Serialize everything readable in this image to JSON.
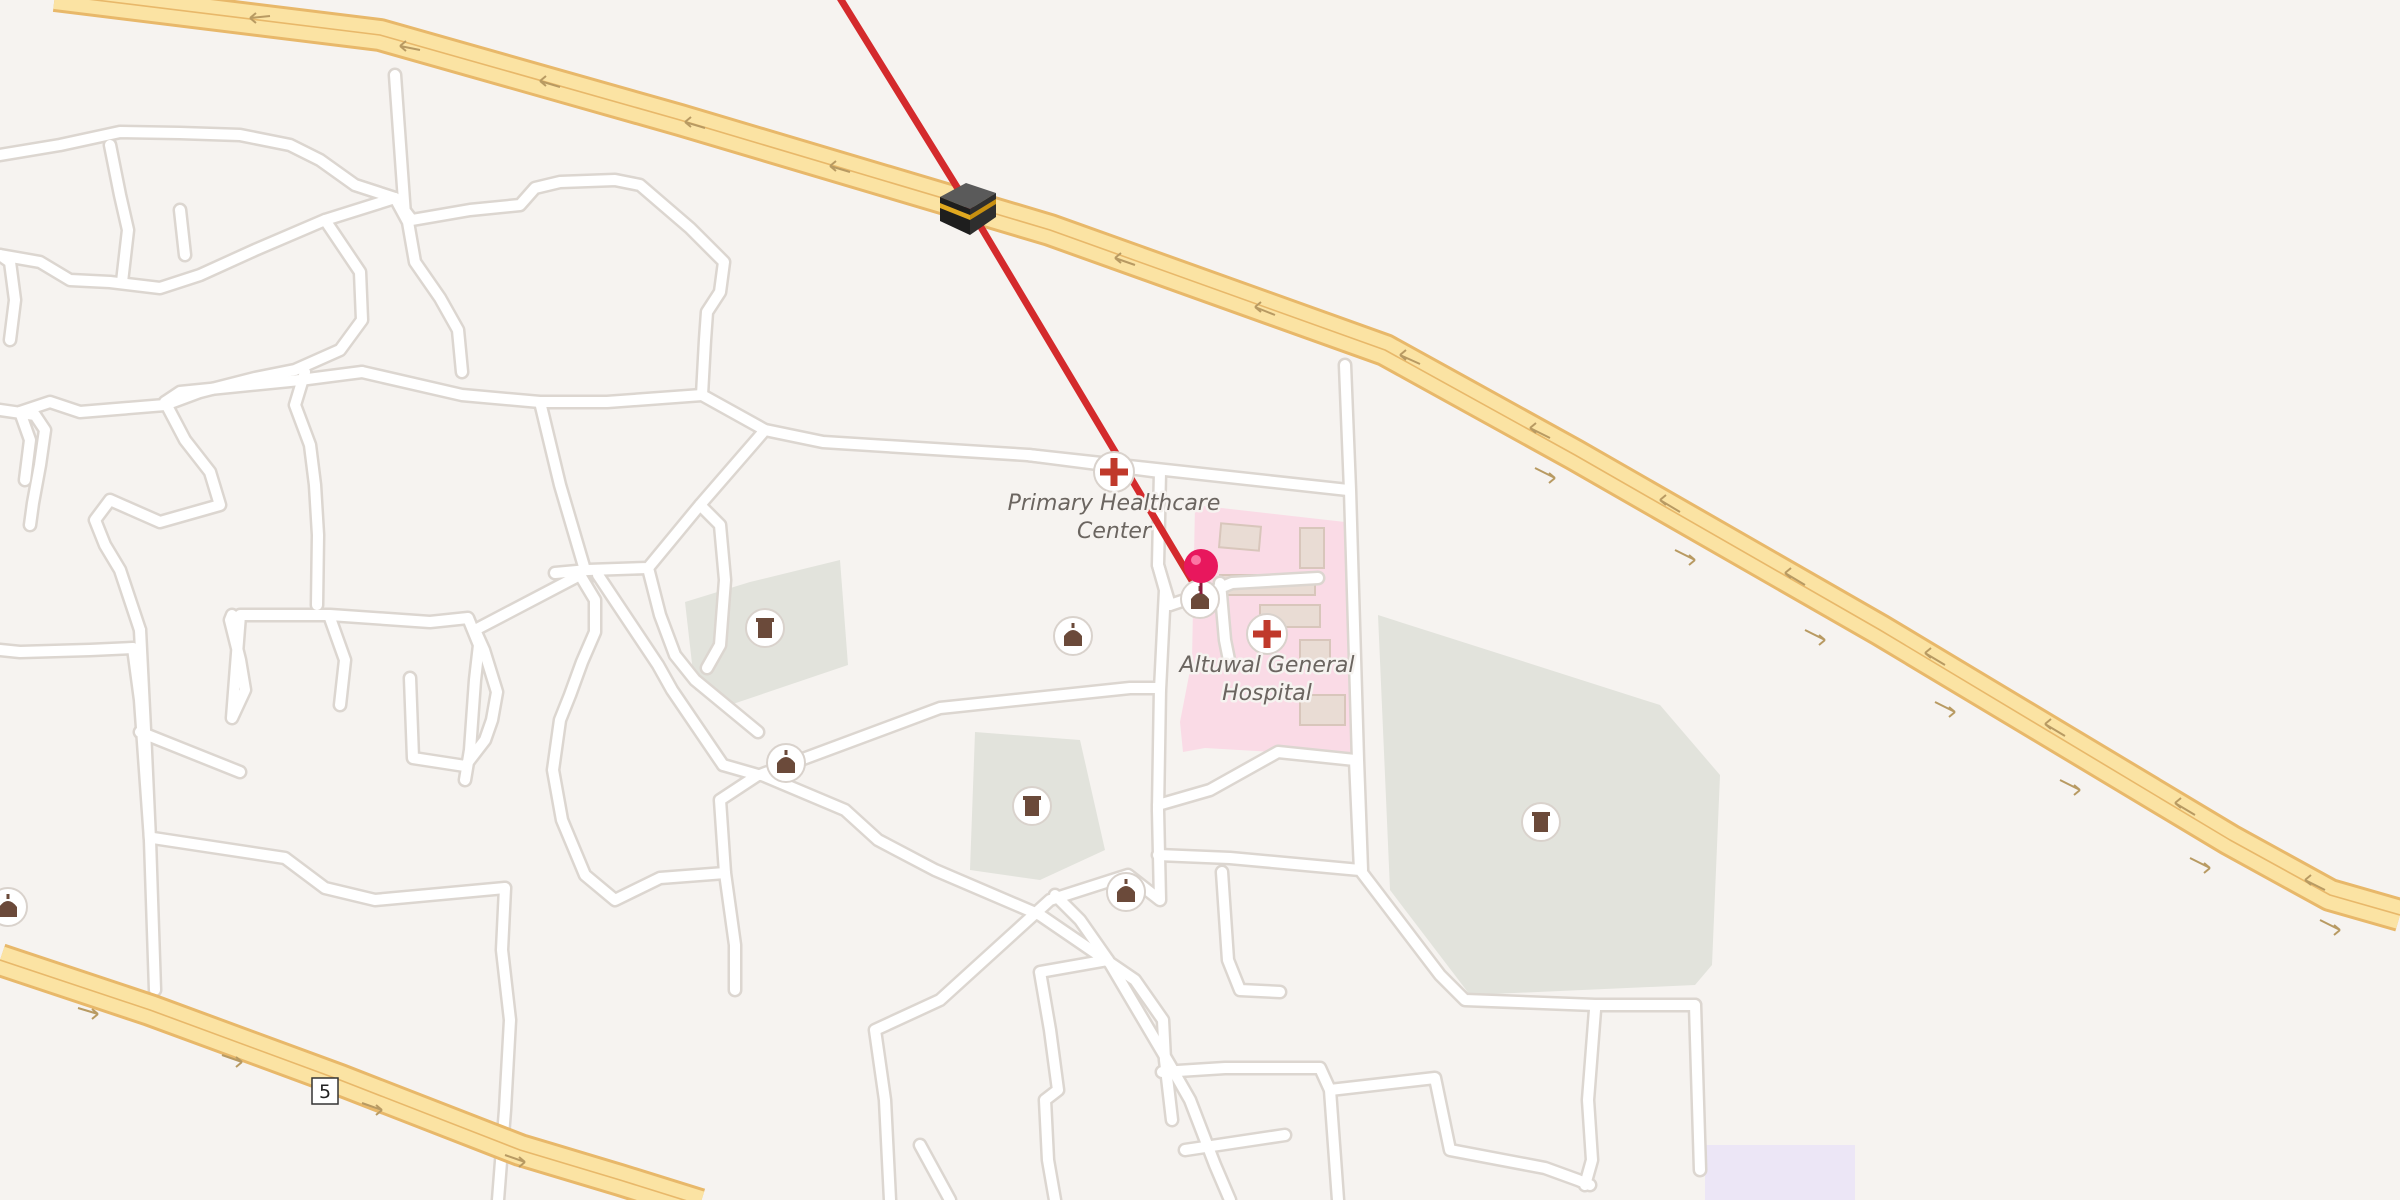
{
  "map": {
    "colors": {
      "background": "#f6f3f0",
      "minor_road": "#ffffff",
      "road_casing": "#dcd6d0",
      "highway_fill": "#fbe3a3",
      "highway_casing": "#e8b86a",
      "hospital_area": "#fadbe6",
      "cemetery_area": "#e2e3dc",
      "route_line": "#d42a2c",
      "pin": "#e8175d",
      "poi_icon": "#6b4a3a",
      "health_icon": "#c0392b"
    },
    "pois": {
      "phc_label_1": "Primary Healthcare",
      "phc_label_2": "Center",
      "hospital_label_1": "Altuwal General",
      "hospital_label_2": "Hospital"
    },
    "shield": {
      "number": "5"
    },
    "icons": {
      "kaaba": "kaaba-icon",
      "pin": "location-pin-icon",
      "mosque": "mosque-icon",
      "cemetery": "cemetery-icon",
      "health": "health-cross-icon"
    }
  }
}
